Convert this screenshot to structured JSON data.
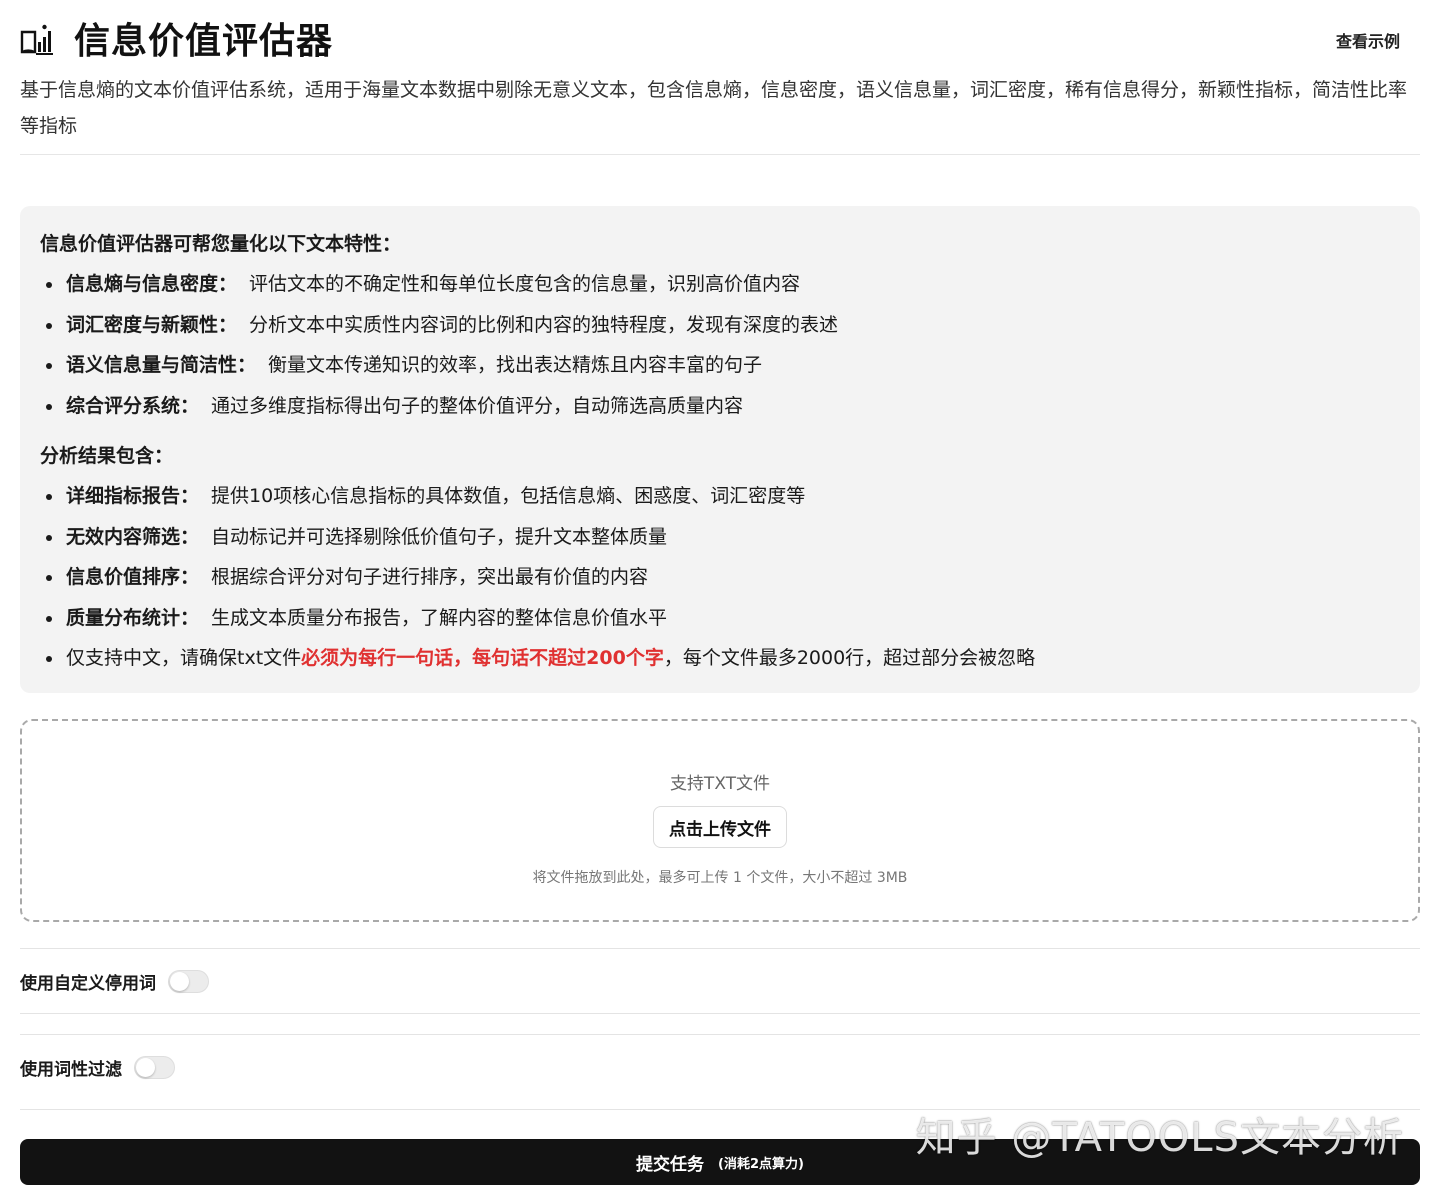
{
  "header": {
    "title": "信息价值评估器",
    "example_link": "查看示例",
    "subtitle": "基于信息熵的文本价值评估系统，适用于海量文本数据中剔除无意义文本，包含信息熵，信息密度，语义信息量，词汇密度，稀有信息得分，新颖性指标，简洁性比率等指标"
  },
  "info": {
    "features_heading": "信息价值评估器可帮您量化以下文本特性：",
    "features": [
      {
        "key": "信息熵与信息密度：",
        "text": "评估文本的不确定性和每单位长度包含的信息量，识别高价值内容"
      },
      {
        "key": "词汇密度与新颖性：",
        "text": "分析文本中实质性内容词的比例和内容的独特程度，发现有深度的表述"
      },
      {
        "key": "语义信息量与简洁性：",
        "text": "衡量文本传递知识的效率，找出表达精炼且内容丰富的句子"
      },
      {
        "key": "综合评分系统：",
        "text": "通过多维度指标得出句子的整体价值评分，自动筛选高质量内容"
      }
    ],
    "results_heading": "分析结果包含：",
    "results": [
      {
        "key": "详细指标报告：",
        "text": "提供10项核心信息指标的具体数值，包括信息熵、困惑度、词汇密度等"
      },
      {
        "key": "无效内容筛选：",
        "text": "自动标记并可选择剔除低价值句子，提升文本整体质量"
      },
      {
        "key": "信息价值排序：",
        "text": "根据综合评分对句子进行排序，突出最有价值的内容"
      },
      {
        "key": "质量分布统计：",
        "text": "生成文本质量分布报告，了解内容的整体信息价值水平"
      }
    ],
    "note": {
      "prefix": "仅支持中文，请确保txt文件",
      "highlight": "必须为每行一句话，每句话不超过200个字",
      "suffix": "，每个文件最多2000行，超过部分会被忽略"
    }
  },
  "upload": {
    "support_text": "支持TXT文件",
    "button_label": "点击上传文件",
    "hint": "将文件拖放到此处，最多可上传 1 个文件，大小不超过 3MB"
  },
  "options": {
    "custom_stopwords_label": "使用自定义停用词",
    "custom_stopwords_enabled": false,
    "pos_filter_label": "使用词性过滤",
    "pos_filter_enabled": false
  },
  "submit": {
    "label": "提交任务",
    "cost": "(消耗2点算力)"
  },
  "watermark": "知乎 @TATOOLS文本分析",
  "colors": {
    "highlight": "#e03131",
    "submit_bg": "#121212",
    "info_bg": "#f3f3f3"
  }
}
